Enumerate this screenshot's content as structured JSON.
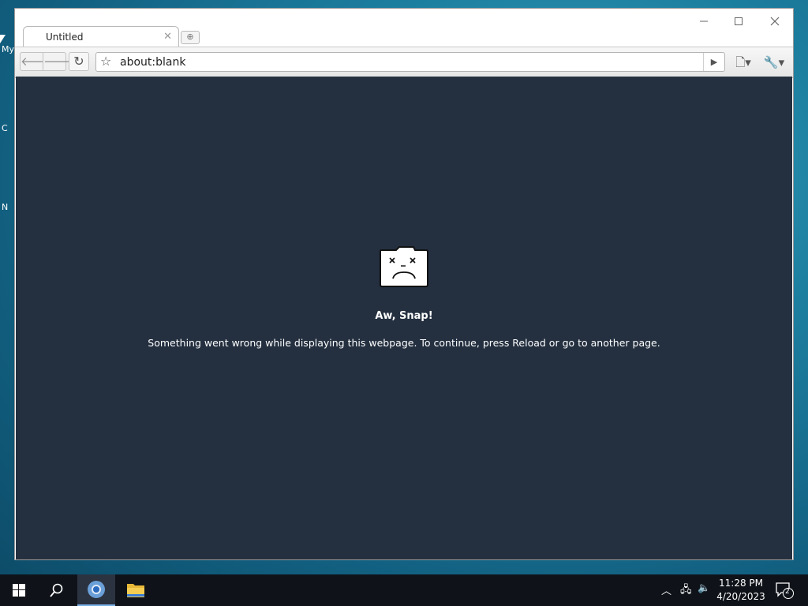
{
  "desktop": {
    "icon_fragments": [
      "My",
      "C",
      "N"
    ]
  },
  "browser": {
    "tab": {
      "title": "Untitled"
    },
    "omnibox": {
      "url": "about:blank"
    }
  },
  "error": {
    "title": "Aw, Snap!",
    "message": "Something went wrong while displaying this webpage. To continue, press Reload or go to another page."
  },
  "taskbar": {
    "time": "11:28 PM",
    "date": "4/20/2023",
    "notification_count": "2"
  },
  "colors": {
    "content_bg": "#243040",
    "taskbar_bg": "#0f1319",
    "active_task_underline": "#7ab0e8"
  }
}
